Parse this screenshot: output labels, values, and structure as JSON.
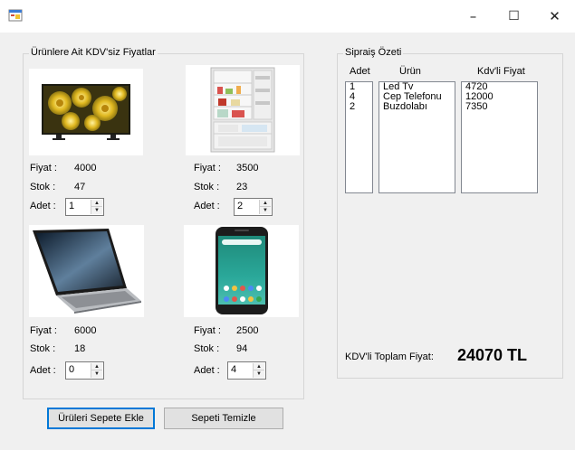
{
  "window": {
    "minimize_glyph": "–",
    "maximize_glyph": "☐",
    "close_glyph": "✕"
  },
  "products_group": {
    "title": "Ürünlere Ait KDV'siz Fiyatlar",
    "price_label": "Fiyat :",
    "stock_label": "Stok :",
    "qty_label": "Adet :",
    "items": [
      {
        "image_icon": "tv-image",
        "price": "4000",
        "stock": "47",
        "qty": "1"
      },
      {
        "image_icon": "refrigerator-image",
        "price": "3500",
        "stock": "23",
        "qty": "2"
      },
      {
        "image_icon": "laptop-image",
        "price": "6000",
        "stock": "18",
        "qty": "0"
      },
      {
        "image_icon": "phone-image",
        "price": "2500",
        "stock": "94",
        "qty": "4"
      }
    ]
  },
  "summary_group": {
    "title": "Sipraiş Özeti",
    "headers": {
      "qty": "Adet",
      "product": "Ürün",
      "price": "Kdv'li Fiyat"
    },
    "qty_list": [
      "1",
      "4",
      "2"
    ],
    "product_list": [
      "Led Tv",
      "Cep Telefonu",
      "Buzdolabı"
    ],
    "price_list": [
      "4720",
      "12000",
      "7350"
    ],
    "total_label": "KDV'li Toplam Fiyat:",
    "total_value": "24070 TL"
  },
  "buttons": {
    "add_to_cart": "Ürüleri Sepete Ekle",
    "clear_cart": "Sepeti Temizle"
  },
  "colors": {
    "accent": "#0078d7",
    "window_bg": "#f0f0f0"
  }
}
